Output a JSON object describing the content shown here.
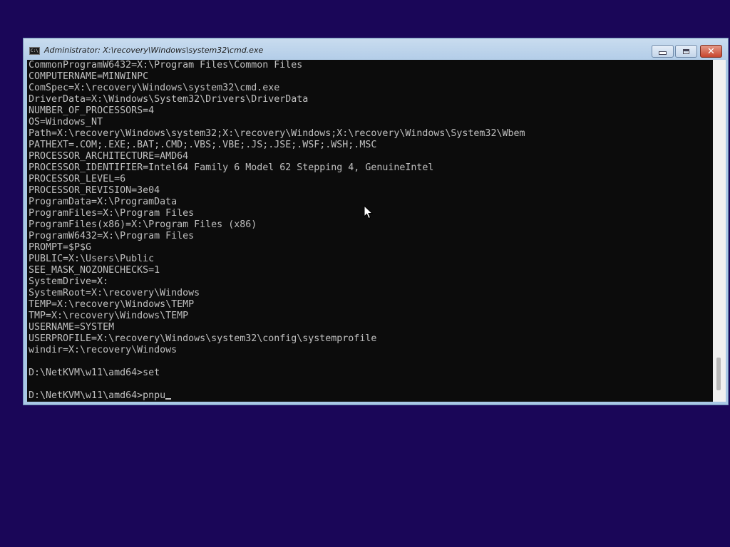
{
  "window": {
    "title": "Administrator: X:\\recovery\\Windows\\system32\\cmd.exe",
    "icon_label": "C:\\",
    "controls": {
      "minimize": "minimize-icon",
      "maximize": "maximize-icon",
      "close": "close-icon"
    }
  },
  "console": {
    "lines": [
      "CommonProgramW6432=X:\\Program Files\\Common Files",
      "COMPUTERNAME=MINWINPC",
      "ComSpec=X:\\recovery\\Windows\\system32\\cmd.exe",
      "DriverData=X:\\Windows\\System32\\Drivers\\DriverData",
      "NUMBER_OF_PROCESSORS=4",
      "OS=Windows_NT",
      "Path=X:\\recovery\\Windows\\system32;X:\\recovery\\Windows;X:\\recovery\\Windows\\System32\\Wbem",
      "PATHEXT=.COM;.EXE;.BAT;.CMD;.VBS;.VBE;.JS;.JSE;.WSF;.WSH;.MSC",
      "PROCESSOR_ARCHITECTURE=AMD64",
      "PROCESSOR_IDENTIFIER=Intel64 Family 6 Model 62 Stepping 4, GenuineIntel",
      "PROCESSOR_LEVEL=6",
      "PROCESSOR_REVISION=3e04",
      "ProgramData=X:\\ProgramData",
      "ProgramFiles=X:\\Program Files",
      "ProgramFiles(x86)=X:\\Program Files (x86)",
      "ProgramW6432=X:\\Program Files",
      "PROMPT=$P$G",
      "PUBLIC=X:\\Users\\Public",
      "SEE_MASK_NOZONECHECKS=1",
      "SystemDrive=X:",
      "SystemRoot=X:\\recovery\\Windows",
      "TEMP=X:\\recovery\\Windows\\TEMP",
      "TMP=X:\\recovery\\Windows\\TEMP",
      "USERNAME=SYSTEM",
      "USERPROFILE=X:\\recovery\\Windows\\system32\\config\\systemprofile",
      "windir=X:\\recovery\\Windows",
      "",
      "D:\\NetKVM\\w11\\amd64>set",
      "",
      "D:\\NetKVM\\w11\\amd64>pnpu"
    ]
  },
  "colors": {
    "desktop": "#1a0658",
    "console_bg": "#0c0c0c",
    "console_fg": "#c0c0c0",
    "close_button": "#c8452d"
  },
  "pointer": "mouse-pointer-icon"
}
